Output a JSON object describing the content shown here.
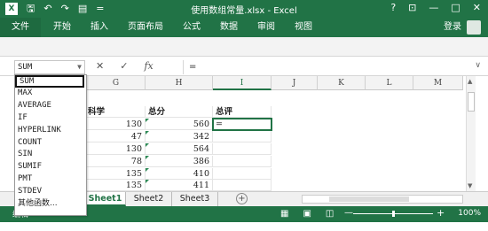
{
  "titlebar": {
    "logo": "X",
    "qat_icons": [
      "save-icon",
      "undo-icon",
      "redo-icon",
      "print-preview-icon",
      "customize-icon"
    ],
    "qat_glyphs": [
      "🖫",
      "↶",
      "↷",
      "▤",
      "⛶"
    ],
    "qat_more": "=",
    "title": "使用数组常量.xlsx - Excel",
    "help": "?",
    "ribbon_display": "⊡",
    "minimize": "—",
    "maximize": "□",
    "close": "✕"
  },
  "ribbon": {
    "file_tab": "文件",
    "tabs": [
      "开始",
      "插入",
      "页面布局",
      "公式",
      "数据",
      "审阅",
      "视图"
    ],
    "login": "登录"
  },
  "formula_bar": {
    "name_box": "SUM",
    "cancel": "✕",
    "enter": "✓",
    "fx": "fx",
    "content": "="
  },
  "function_list": [
    "SUM",
    "MAX",
    "AVERAGE",
    "IF",
    "HYPERLINK",
    "COUNT",
    "SIN",
    "SUMIF",
    "PMT",
    "STDEV",
    "其他函数..."
  ],
  "columns": [
    "G",
    "H",
    "I",
    "J",
    "K",
    "L",
    "M"
  ],
  "header_row": {
    "g": "科学",
    "h": "总分",
    "i": "总评"
  },
  "rows": [
    {
      "g": "130",
      "h": "560",
      "i": "="
    },
    {
      "g": "47",
      "h": "342",
      "i": ""
    },
    {
      "g": "130",
      "h": "564",
      "i": ""
    },
    {
      "g": "78",
      "h": "386",
      "i": ""
    },
    {
      "g": "135",
      "h": "410",
      "i": ""
    },
    {
      "g": "135",
      "h": "411",
      "i": ""
    }
  ],
  "sheets": [
    "Sheet1",
    "Sheet2",
    "Sheet3"
  ],
  "add_sheet": "+",
  "status": {
    "mode": "编辑",
    "zoom": "100%",
    "zoom_minus": "—",
    "zoom_plus": "+"
  },
  "colors": {
    "accent": "#217346",
    "selection": "#217346"
  }
}
